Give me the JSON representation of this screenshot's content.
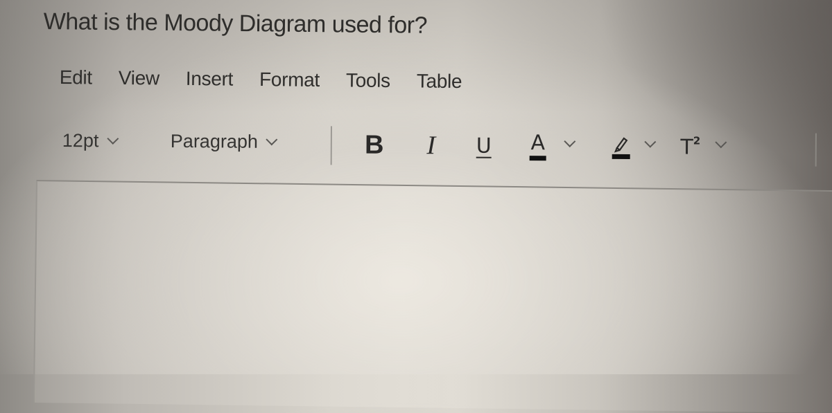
{
  "question": {
    "text": "What is the Moody Diagram used for?"
  },
  "menubar": {
    "items": [
      {
        "label": "Edit"
      },
      {
        "label": "View"
      },
      {
        "label": "Insert"
      },
      {
        "label": "Format"
      },
      {
        "label": "Tools"
      },
      {
        "label": "Table"
      }
    ]
  },
  "toolbar": {
    "font_size": {
      "value": "12pt",
      "icon": "chevron-down-icon"
    },
    "block_format": {
      "value": "Paragraph",
      "icon": "chevron-down-icon"
    },
    "bold": {
      "glyph": "B",
      "icon": "bold-icon"
    },
    "italic": {
      "glyph": "I",
      "icon": "italic-icon"
    },
    "underline": {
      "glyph": "U",
      "icon": "underline-icon"
    },
    "text_color": {
      "glyph": "A",
      "icon": "text-color-icon",
      "color": "#111111"
    },
    "highlight": {
      "icon": "highlighter-icon",
      "color": "#111111"
    },
    "superscript": {
      "glyph": "T",
      "sup": "2",
      "icon": "superscript-icon"
    }
  },
  "editor": {
    "content": ""
  }
}
